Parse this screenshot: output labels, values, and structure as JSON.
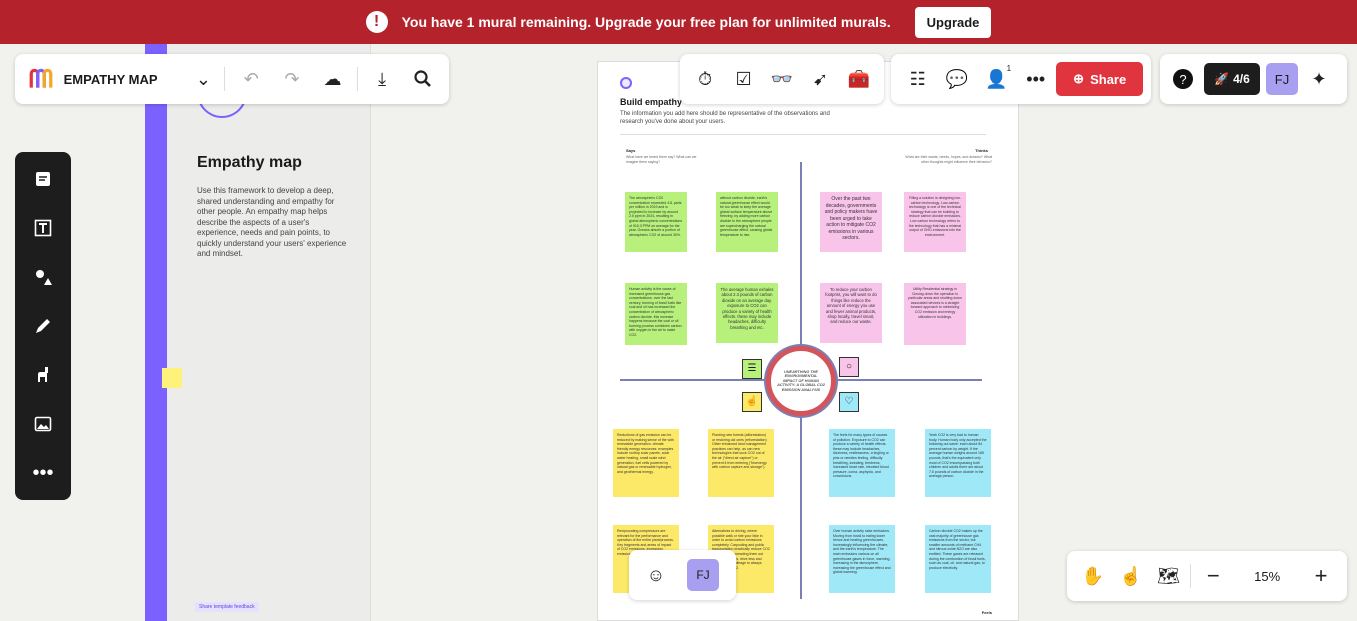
{
  "banner": {
    "text": "You have 1 mural remaining. Upgrade your free plan for unlimited murals.",
    "button": "Upgrade"
  },
  "top_left": {
    "title": "EMPATHY MAP"
  },
  "collab": {
    "badge": "1",
    "share": "Share",
    "progress": "4/6",
    "avatar": "FJ"
  },
  "template": {
    "title": "Empathy map",
    "description": "Use this framework to develop a deep, shared understanding and empathy for other people. An empathy map helps describe the aspects of a user's experience, needs and pain points, to quickly understand your users' experience and mindset.",
    "feedback": "Share template feedback"
  },
  "board": {
    "title": "Build empathy",
    "subtitle": "The information you add here should be representative of the observations and research you've done about your users.",
    "says": "Says",
    "says_hint": "What have we heard them say? What can we imagine them saying?",
    "thinks": "Thinks",
    "thinks_hint": "What are their wants, needs, hopes, and dreams? What other thoughts might influence their behavior?",
    "feels": "Feels",
    "center": "UNEARTHING THE ENVIRONMENTAL IMPACT OF HUMAN ACTIVITY: A GLOBAL CO2 EMISSION ANALYSIS",
    "notes": {
      "g1": "The atmospheric CO2 concentration exceeded 411 parts per million in 2019 and is projected to increase by around 2.5 ppm in 2024, resulting in global atmospheric concentrations of 915.3 PPM on average for the year. Oceans absorb a portion of atmospheric CO2 of around 30%.",
      "g2": "without carbon dioxide, earth's natural greenhouse effect would be too weak to keep the average global surface temperature above freezing. by adding more carbon dioxide to the atmosphere people are supercharging the natural greenhouse effect, causing global temperature to rise.",
      "p1": "Over the past two decades, governments and policy makers have been urged to take action to mitigate CO2 emissions in various sectors.",
      "p2": "Filling a solution is designing low-carbon technology. Low-carbon technology is one of the technical strategy that can be building to reduce carbon dioxide emissions. Low carbon technology refers to the technology that has a minimal output of GHG emissions into the environment.",
      "g3": "Human activity is the cause of increased greenhouse gas concentrations. over the last century, burning of fossil fuels like coal and oil has increased the concentration of atmospheric carbon dioxide. this increase happens because the coal or oil burning process combines carbon with oxygen in the air to make CO2.",
      "g4": "The average human exhales about 2.3 pounds of carbon dioxide on an average day. exposure to CO2 can produce a variety of health effects. these may include headaches, difficulty breathing and etc.",
      "p3": "To reduce your carbon footprint, you will want to do things like reduce the amount of energy you use and fewer animal products, shop locally, travel smart, and reduce our waste.",
      "p4": "Utility Residential strategy in Closing down the operation in particular areas and shutting down associated devices is a straight forward approach to minimizing CO2 emission and energy utilization in buildings.",
      "y1": "Reductions of gas emission can be reduced by making sense of the with renewable generation. climate friendly energy resources: examples include rooftop solar panels, solar water heating, small scale wind generation, fuel cells powered by natural gas or renewable hydrogen, and geothermal energy.",
      "y2": "Planting new forests (afforestation) or restoring old ones (reforestation) Other enhanced land management practices can help, as can new technologies that suck CO2 out of the air (\"direct air capture\") or prevent it from entering (\"bioenergy with carbon capture and storage\").",
      "b1": "The feels for many types of causes of pollution. Exposure to CO2 can produce a variety of health effects. these may include headaches, dizziness, restlessness, a tingling or pins or needles feeling, difficulty breathing, sweating, tiredness, increased heart rate, elevated blood pressure, coma, asphyxia, and convulsions.",
      "b2": "Yeah CO2 is very bad to human body. Human body only accepted the following out same: each about 84 percent carbon by weight. If the average human weighs around 165 pounds, that's the equivalent only most of CO2 encompassing both children and adults there are about 7.6 pounds of carbon dioxide in the average person.",
      "y3": "Reciprocating compressors are relevant for the performance and operation of the entire plant/process. Key fragments and areas of impact of CO2 emissions, increasing emission.",
      "y4": "Alternatives to driving, where possible walk or ride your bike in order to avoid carbon emissions completely. Carpooling and public transportation drastically reduce CO2 emissions by spreading them out over many riders. drive less and consider high mileage to always lower fewer CO2.",
      "b3": "Over human activity raise emissions. Moving from fossil to eating lower hence and heating greenhouses. Increasingly influencing the climate, and the earth's temperature. The main emissions various on all greenhouse gases in force, warming, increasing in the atmosphere, increasing the greenhouse effect and global warming.",
      "b4": "Carbon dioxide CO2 makes up the vast majority of greenhouse gas emissions from the sector, but smaller amounts of methane CH4 and nitrous oxide N2O are also emitted. These gases are released during the combustion of fossil fuels, such as coal, oil, and natural gas, to produce electricity."
    }
  },
  "bottom": {
    "avatar": "FJ",
    "zoom": "15%"
  },
  "colors": {
    "banner": "#b4232c",
    "accent": "#7b61ff",
    "share": "#e0353f"
  }
}
